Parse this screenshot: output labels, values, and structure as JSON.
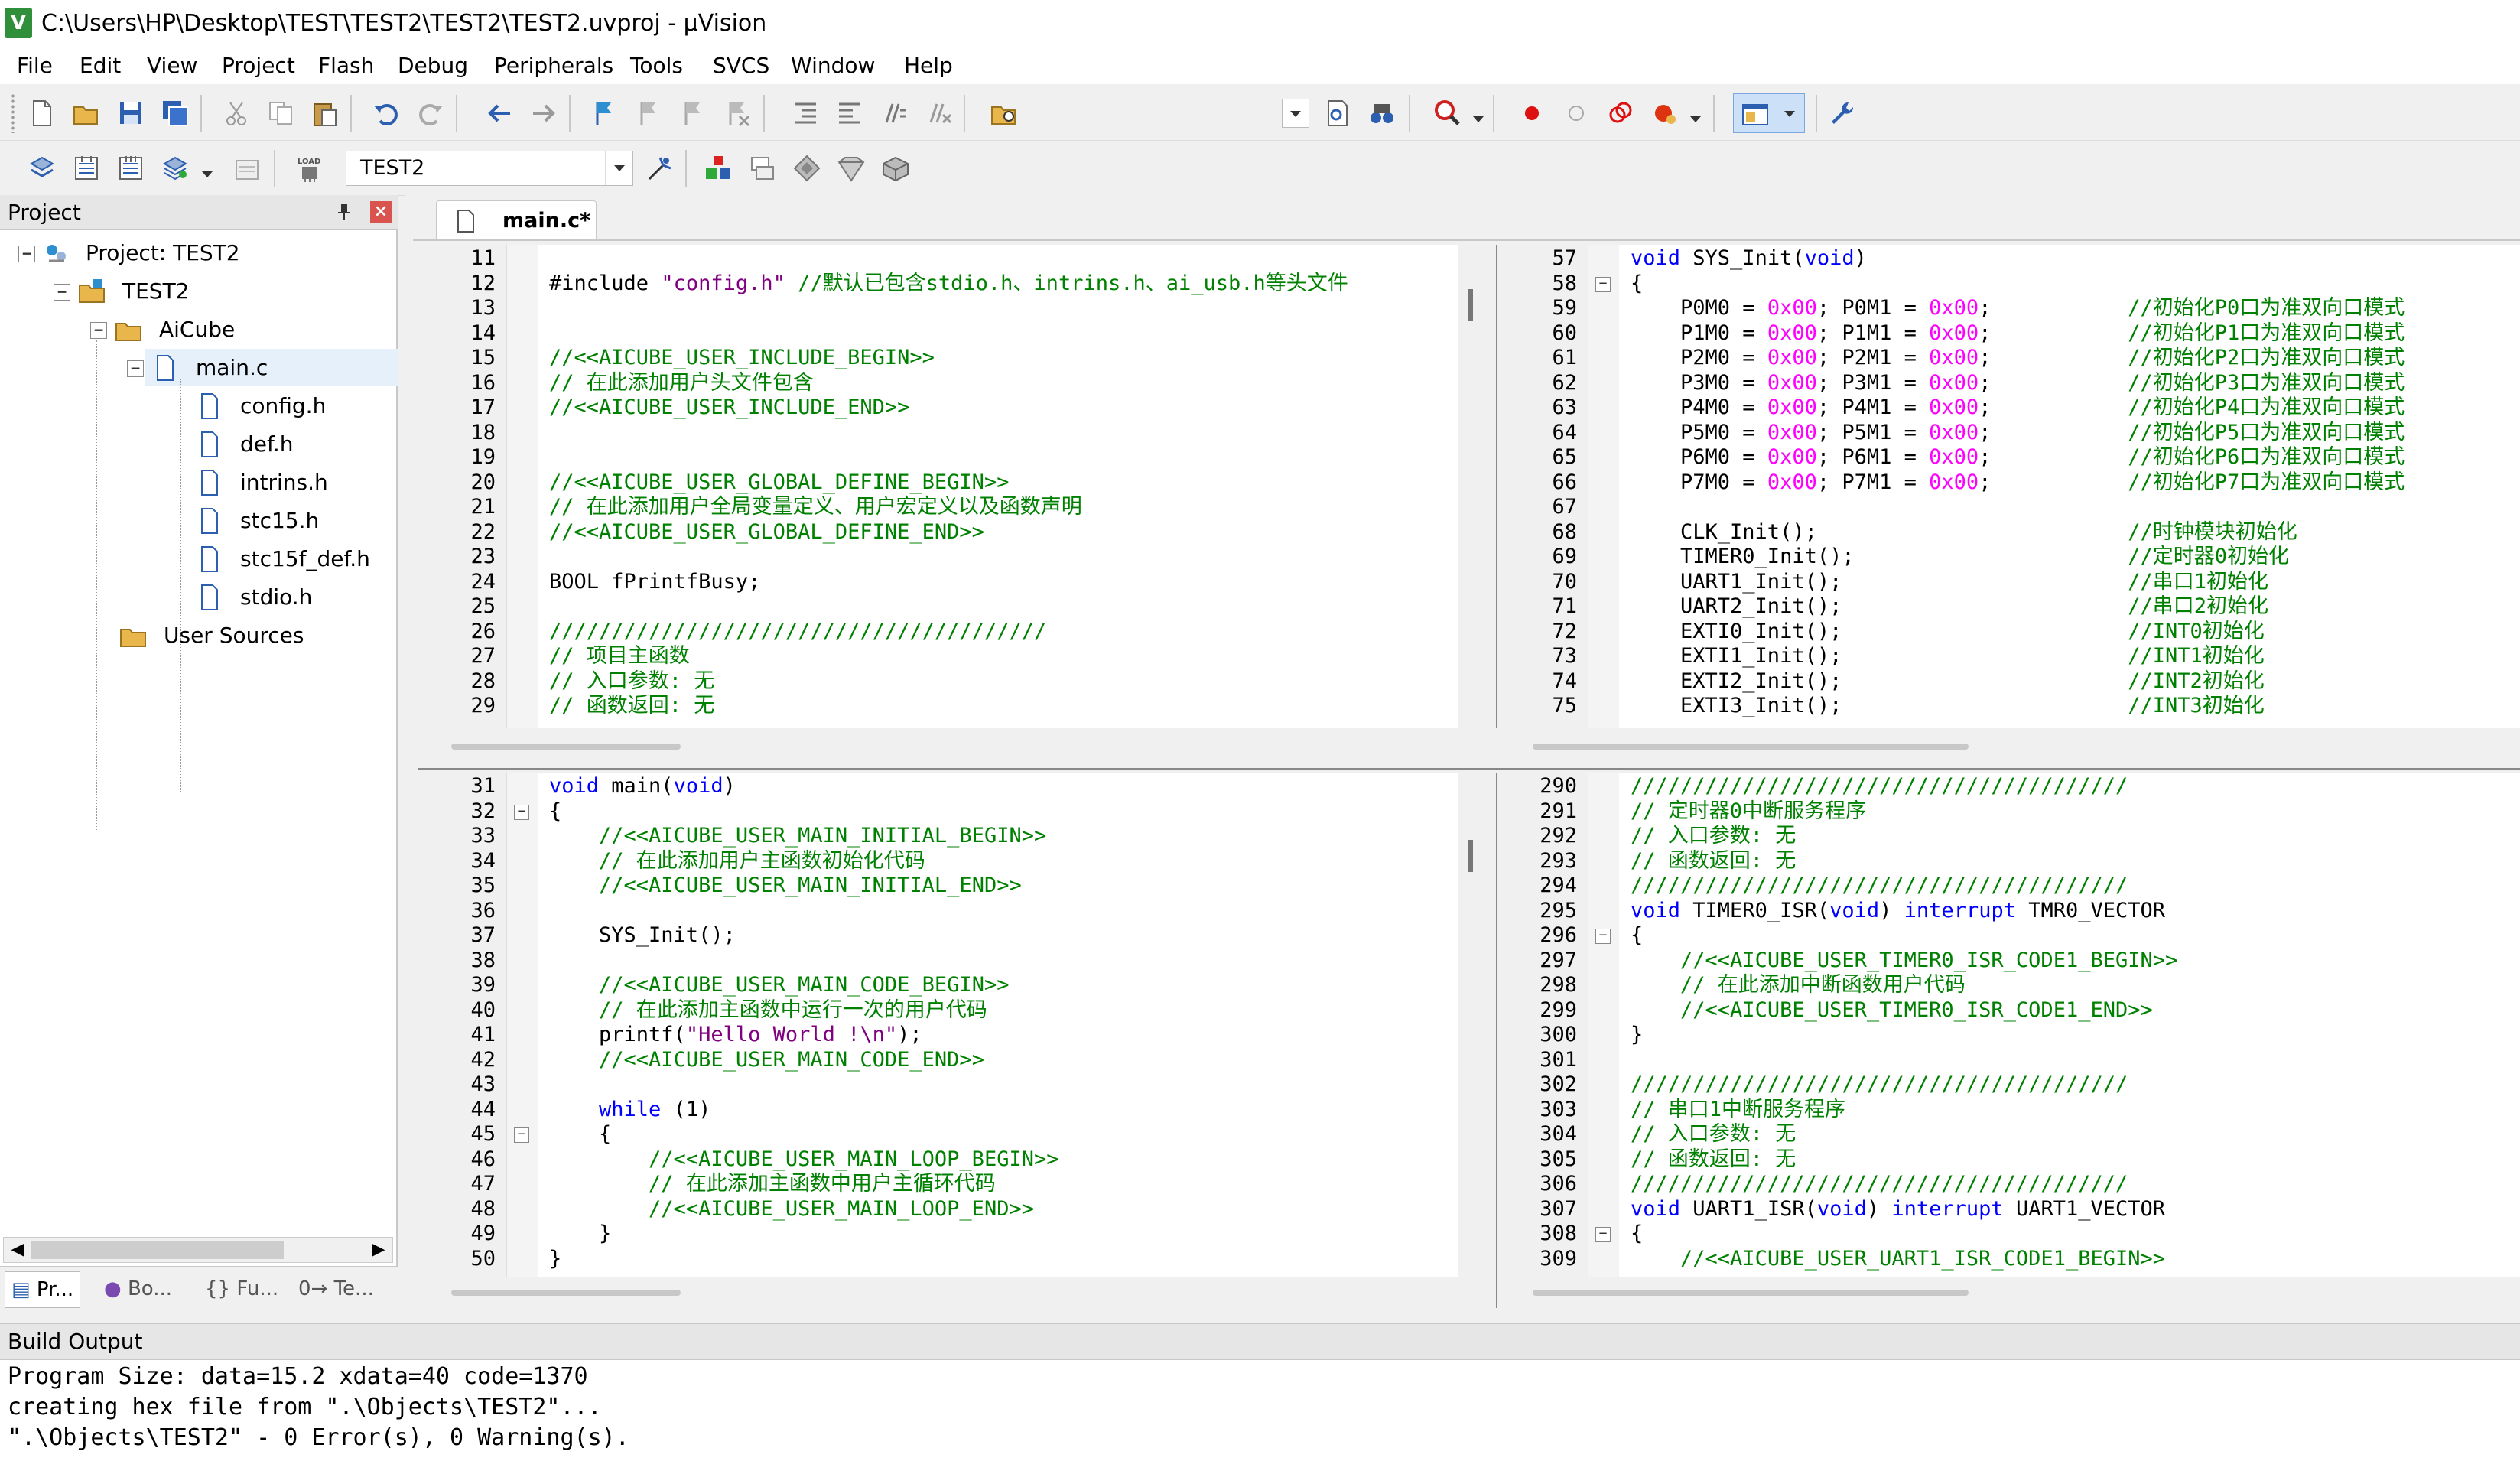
{
  "window": {
    "title": "C:\\Users\\HP\\Desktop\\TEST\\TEST2\\TEST2\\TEST2.uvproj - µVision",
    "app_icon": "V"
  },
  "menu": [
    "File",
    "Edit",
    "View",
    "Project",
    "Flash",
    "Debug",
    "Peripherals",
    "Tools",
    "SVCS",
    "Window",
    "Help"
  ],
  "toolbar2": {
    "target_select": "TEST2"
  },
  "project": {
    "header": "Project",
    "pin_icon": "pin-icon",
    "close_icon": "close-icon",
    "root": "Project: TEST2",
    "target": "TEST2",
    "group_aicube": "AiCube",
    "main_file": "main.c",
    "headers": [
      "config.h",
      "def.h",
      "intrins.h",
      "stc15.h",
      "stc15f_def.h",
      "stdio.h"
    ],
    "group_user": "User Sources",
    "tabs": [
      "Pr...",
      "Bo...",
      "{} Fu...",
      "0→ Te..."
    ]
  },
  "editor": {
    "tab_label": "main.c*",
    "pane_tl": {
      "start": 11,
      "lines": [
        [],
        [
          [
            "pp",
            "#include "
          ],
          [
            "st",
            "\"config.h\""
          ],
          [
            "cm",
            " //默认已包含stdio.h、intrins.h、ai_usb.h等头文件"
          ]
        ],
        [],
        [],
        [
          [
            "cm",
            "//<<AICUBE_USER_INCLUDE_BEGIN>>"
          ]
        ],
        [
          [
            "cm",
            "// 在此添加用户头文件包含"
          ]
        ],
        [
          [
            "cm",
            "//<<AICUBE_USER_INCLUDE_END>>"
          ]
        ],
        [],
        [],
        [
          [
            "cm",
            "//<<AICUBE_USER_GLOBAL_DEFINE_BEGIN>>"
          ]
        ],
        [
          [
            "cm",
            "// 在此添加用户全局变量定义、用户宏定义以及函数声明"
          ]
        ],
        [
          [
            "cm",
            "//<<AICUBE_USER_GLOBAL_DEFINE_END>>"
          ]
        ],
        [],
        [
          [
            "tx",
            "BOOL fPrintfBusy;"
          ]
        ],
        [],
        [
          [
            "cm",
            "////////////////////////////////////////"
          ]
        ],
        [
          [
            "cm",
            "// 项目主函数"
          ]
        ],
        [
          [
            "cm",
            "// 入口参数: 无"
          ]
        ],
        [
          [
            "cm",
            "// 函数返回: 无"
          ]
        ]
      ]
    },
    "pane_tr": {
      "start": 57,
      "lines": [
        [
          [
            "kw",
            "void"
          ],
          [
            "tx",
            " SYS_Init("
          ],
          [
            "kw",
            "void"
          ],
          [
            "tx",
            ")"
          ]
        ],
        [
          [
            "tx",
            "{"
          ]
        ],
        [
          [
            "tx",
            "    P0M0 = "
          ],
          [
            "nm",
            "0x00"
          ],
          [
            "tx",
            "; P0M1 = "
          ],
          [
            "nm",
            "0x00"
          ],
          [
            "tx",
            ";           "
          ],
          [
            "cm",
            "//初始化P0口为准双向口模式"
          ]
        ],
        [
          [
            "tx",
            "    P1M0 = "
          ],
          [
            "nm",
            "0x00"
          ],
          [
            "tx",
            "; P1M1 = "
          ],
          [
            "nm",
            "0x00"
          ],
          [
            "tx",
            ";           "
          ],
          [
            "cm",
            "//初始化P1口为准双向口模式"
          ]
        ],
        [
          [
            "tx",
            "    P2M0 = "
          ],
          [
            "nm",
            "0x00"
          ],
          [
            "tx",
            "; P2M1 = "
          ],
          [
            "nm",
            "0x00"
          ],
          [
            "tx",
            ";           "
          ],
          [
            "cm",
            "//初始化P2口为准双向口模式"
          ]
        ],
        [
          [
            "tx",
            "    P3M0 = "
          ],
          [
            "nm",
            "0x00"
          ],
          [
            "tx",
            "; P3M1 = "
          ],
          [
            "nm",
            "0x00"
          ],
          [
            "tx",
            ";           "
          ],
          [
            "cm",
            "//初始化P3口为准双向口模式"
          ]
        ],
        [
          [
            "tx",
            "    P4M0 = "
          ],
          [
            "nm",
            "0x00"
          ],
          [
            "tx",
            "; P4M1 = "
          ],
          [
            "nm",
            "0x00"
          ],
          [
            "tx",
            ";           "
          ],
          [
            "cm",
            "//初始化P4口为准双向口模式"
          ]
        ],
        [
          [
            "tx",
            "    P5M0 = "
          ],
          [
            "nm",
            "0x00"
          ],
          [
            "tx",
            "; P5M1 = "
          ],
          [
            "nm",
            "0x00"
          ],
          [
            "tx",
            ";           "
          ],
          [
            "cm",
            "//初始化P5口为准双向口模式"
          ]
        ],
        [
          [
            "tx",
            "    P6M0 = "
          ],
          [
            "nm",
            "0x00"
          ],
          [
            "tx",
            "; P6M1 = "
          ],
          [
            "nm",
            "0x00"
          ],
          [
            "tx",
            ";           "
          ],
          [
            "cm",
            "//初始化P6口为准双向口模式"
          ]
        ],
        [
          [
            "tx",
            "    P7M0 = "
          ],
          [
            "nm",
            "0x00"
          ],
          [
            "tx",
            "; P7M1 = "
          ],
          [
            "nm",
            "0x00"
          ],
          [
            "tx",
            ";           "
          ],
          [
            "cm",
            "//初始化P7口为准双向口模式"
          ]
        ],
        [],
        [
          [
            "tx",
            "    CLK_Init();                         "
          ],
          [
            "cm",
            "//时钟模块初始化"
          ]
        ],
        [
          [
            "tx",
            "    TIMER0_Init();                      "
          ],
          [
            "cm",
            "//定时器0初始化"
          ]
        ],
        [
          [
            "tx",
            "    UART1_Init();                       "
          ],
          [
            "cm",
            "//串口1初始化"
          ]
        ],
        [
          [
            "tx",
            "    UART2_Init();                       "
          ],
          [
            "cm",
            "//串口2初始化"
          ]
        ],
        [
          [
            "tx",
            "    EXTI0_Init();                       "
          ],
          [
            "cm",
            "//INT0初始化"
          ]
        ],
        [
          [
            "tx",
            "    EXTI1_Init();                       "
          ],
          [
            "cm",
            "//INT1初始化"
          ]
        ],
        [
          [
            "tx",
            "    EXTI2_Init();                       "
          ],
          [
            "cm",
            "//INT2初始化"
          ]
        ],
        [
          [
            "tx",
            "    EXTI3_Init();                       "
          ],
          [
            "cm",
            "//INT3初始化"
          ]
        ]
      ]
    },
    "pane_bl": {
      "start": 31,
      "lines": [
        [
          [
            "kw",
            "void"
          ],
          [
            "tx",
            " main("
          ],
          [
            "kw",
            "void"
          ],
          [
            "tx",
            ")"
          ]
        ],
        [
          [
            "tx",
            "{"
          ]
        ],
        [
          [
            "tx",
            "    "
          ],
          [
            "cm",
            "//<<AICUBE_USER_MAIN_INITIAL_BEGIN>>"
          ]
        ],
        [
          [
            "tx",
            "    "
          ],
          [
            "cm",
            "// 在此添加用户主函数初始化代码"
          ]
        ],
        [
          [
            "tx",
            "    "
          ],
          [
            "cm",
            "//<<AICUBE_USER_MAIN_INITIAL_END>>"
          ]
        ],
        [],
        [
          [
            "tx",
            "    SYS_Init();"
          ]
        ],
        [],
        [
          [
            "tx",
            "    "
          ],
          [
            "cm",
            "//<<AICUBE_USER_MAIN_CODE_BEGIN>>"
          ]
        ],
        [
          [
            "tx",
            "    "
          ],
          [
            "cm",
            "// 在此添加主函数中运行一次的用户代码"
          ]
        ],
        [
          [
            "tx",
            "    printf("
          ],
          [
            "st",
            "\"Hello World !\\n\""
          ],
          [
            "tx",
            ");"
          ]
        ],
        [
          [
            "tx",
            "    "
          ],
          [
            "cm",
            "//<<AICUBE_USER_MAIN_CODE_END>>"
          ]
        ],
        [],
        [
          [
            "tx",
            "    "
          ],
          [
            "kw",
            "while"
          ],
          [
            "tx",
            " (1)"
          ]
        ],
        [
          [
            "tx",
            "    {"
          ]
        ],
        [
          [
            "tx",
            "        "
          ],
          [
            "cm",
            "//<<AICUBE_USER_MAIN_LOOP_BEGIN>>"
          ]
        ],
        [
          [
            "tx",
            "        "
          ],
          [
            "cm",
            "// 在此添加主函数中用户主循环代码"
          ]
        ],
        [
          [
            "tx",
            "        "
          ],
          [
            "cm",
            "//<<AICUBE_USER_MAIN_LOOP_END>>"
          ]
        ],
        [
          [
            "tx",
            "    }"
          ]
        ],
        [
          [
            "tx",
            "}"
          ]
        ]
      ]
    },
    "pane_br": {
      "start": 290,
      "lines": [
        [
          [
            "cm",
            "////////////////////////////////////////"
          ]
        ],
        [
          [
            "cm",
            "// 定时器0中断服务程序"
          ]
        ],
        [
          [
            "cm",
            "// 入口参数: 无"
          ]
        ],
        [
          [
            "cm",
            "// 函数返回: 无"
          ]
        ],
        [
          [
            "cm",
            "////////////////////////////////////////"
          ]
        ],
        [
          [
            "kw",
            "void"
          ],
          [
            "tx",
            " TIMER0_ISR("
          ],
          [
            "kw",
            "void"
          ],
          [
            "tx",
            ") "
          ],
          [
            "kw",
            "interrupt"
          ],
          [
            "tx",
            " TMR0_VECTOR"
          ]
        ],
        [
          [
            "tx",
            "{"
          ]
        ],
        [
          [
            "tx",
            "    "
          ],
          [
            "cm",
            "//<<AICUBE_USER_TIMER0_ISR_CODE1_BEGIN>>"
          ]
        ],
        [
          [
            "tx",
            "    "
          ],
          [
            "cm",
            "// 在此添加中断函数用户代码"
          ]
        ],
        [
          [
            "tx",
            "    "
          ],
          [
            "cm",
            "//<<AICUBE_USER_TIMER0_ISR_CODE1_END>>"
          ]
        ],
        [
          [
            "tx",
            "}"
          ]
        ],
        [],
        [
          [
            "cm",
            "////////////////////////////////////////"
          ]
        ],
        [
          [
            "cm",
            "// 串口1中断服务程序"
          ]
        ],
        [
          [
            "cm",
            "// 入口参数: 无"
          ]
        ],
        [
          [
            "cm",
            "// 函数返回: 无"
          ]
        ],
        [
          [
            "cm",
            "////////////////////////////////////////"
          ]
        ],
        [
          [
            "kw",
            "void"
          ],
          [
            "tx",
            " UART1_ISR("
          ],
          [
            "kw",
            "void"
          ],
          [
            "tx",
            ") "
          ],
          [
            "kw",
            "interrupt"
          ],
          [
            "tx",
            " UART1_VECTOR"
          ]
        ],
        [
          [
            "tx",
            "{"
          ]
        ],
        [
          [
            "tx",
            "    "
          ],
          [
            "cm",
            "//<<AICUBE_USER_UART1_ISR_CODE1_BEGIN>>"
          ]
        ]
      ]
    }
  },
  "build_output": {
    "header": "Build Output",
    "lines": [
      "Program Size: data=15.2 xdata=40 code=1370",
      "creating hex file from \".\\Objects\\TEST2\"...",
      "\".\\Objects\\TEST2\" - 0 Error(s), 0 Warning(s)."
    ]
  },
  "colors": {
    "comment": "#008000",
    "keyword": "#0000ff",
    "string": "#800080",
    "number": "#ff00ff",
    "gutter": "#f0f0f0"
  }
}
